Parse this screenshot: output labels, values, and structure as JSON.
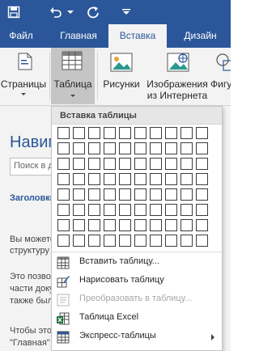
{
  "tabs": [
    {
      "label": "Файл"
    },
    {
      "label": "Главная"
    },
    {
      "label": "Вставка"
    },
    {
      "label": "Дизайн"
    }
  ],
  "ribbon": {
    "pages": "Страницы",
    "table": "Таблица",
    "pictures": "Рисунки",
    "online_pictures": "Изображения из Интернета",
    "shapes": "Фигуры"
  },
  "nav": {
    "title": "Навигация",
    "search": "Поиск в документе",
    "headings": "Заголовки",
    "lines": [
      "Вы можете",
      "структуру",
      "Это позволяет",
      "части документа",
      "также были",
      "Чтобы это",
      "\"Главная\""
    ]
  },
  "dropdown": {
    "header": "Вставка таблицы",
    "grid_cols": 10,
    "grid_rows": 8,
    "items": [
      {
        "label": "Вставить таблицу...",
        "icon": "insert-table-icon",
        "disabled": false
      },
      {
        "label": "Нарисовать таблицу",
        "icon": "draw-table-icon",
        "disabled": false
      },
      {
        "label": "Преобразовать в таблицу...",
        "icon": "convert-table-icon",
        "disabled": true
      },
      {
        "label": "Таблица Excel",
        "icon": "excel-table-icon",
        "disabled": false
      },
      {
        "label": "Экспресс-таблицы",
        "icon": "quick-tables-icon",
        "disabled": false,
        "submenu": true
      }
    ]
  }
}
